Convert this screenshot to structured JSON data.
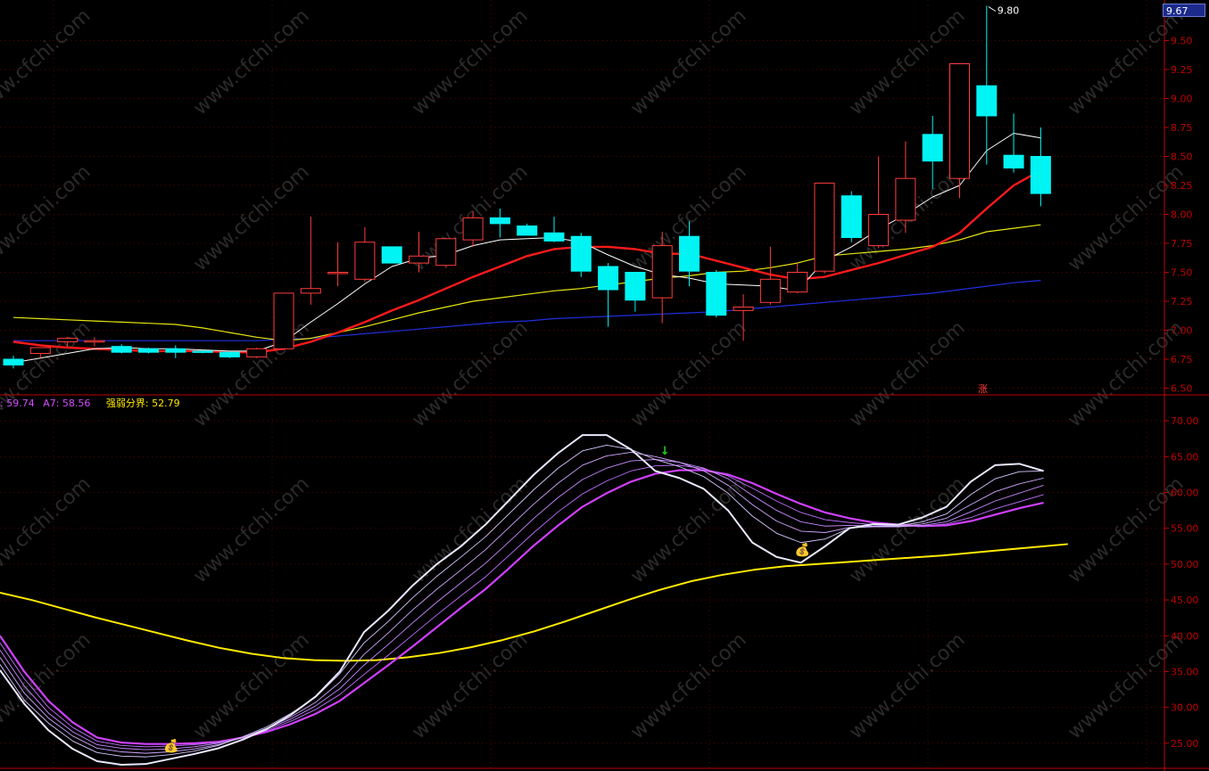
{
  "colors": {
    "up": "#ff3b3b",
    "down": "#00f4f4",
    "ma5": "#ffffff",
    "ma10": "#ff1a1a",
    "ma20": "#e6e60f",
    "ma60": "#1f2fe0",
    "boundary": "#ffea00",
    "grid": "#5a0000",
    "axis": "#c00000",
    "watermark": "#2a2a2a"
  },
  "price_panel": {
    "y_ticks": [
      "9.50",
      "9.25",
      "9.00",
      "8.75",
      "8.50",
      "8.25",
      "8.00",
      "7.75",
      "7.50",
      "7.25",
      "7.00",
      "6.75",
      "6.50"
    ],
    "last_price_label": "9.67",
    "high_marker_label": "9.80",
    "zhang_label": "涨"
  },
  "indicator_panel": {
    "y_ticks": [
      "70.00",
      "65.00",
      "60.00",
      "55.00",
      "50.00",
      "45.00",
      "40.00",
      "35.00",
      "30.00",
      "25.00"
    ],
    "legend_a6": ": 59.74",
    "legend_a7": "A7: 58.56",
    "legend_boundary": "强弱分界: 52.79",
    "money_bag_icon": "💰",
    "arrow_icon": "↓"
  },
  "watermark_text": "www.cfchi.com",
  "chart_data": {
    "type": "candlestick",
    "price_ylim": [
      6.45,
      9.85
    ],
    "candles": [
      {
        "o": 6.75,
        "h": 6.78,
        "l": 6.67,
        "c": 6.7
      },
      {
        "o": 6.8,
        "h": 6.85,
        "l": 6.76,
        "c": 6.85
      },
      {
        "o": 6.9,
        "h": 6.94,
        "l": 6.86,
        "c": 6.93
      },
      {
        "o": 6.91,
        "h": 6.94,
        "l": 6.86,
        "c": 6.91
      },
      {
        "o": 6.86,
        "h": 6.88,
        "l": 6.8,
        "c": 6.81
      },
      {
        "o": 6.84,
        "h": 6.85,
        "l": 6.8,
        "c": 6.81
      },
      {
        "o": 6.84,
        "h": 6.87,
        "l": 6.76,
        "c": 6.81
      },
      {
        "o": 6.82,
        "h": 6.83,
        "l": 6.8,
        "c": 6.81
      },
      {
        "o": 6.81,
        "h": 6.82,
        "l": 6.76,
        "c": 6.77
      },
      {
        "o": 6.77,
        "h": 6.85,
        "l": 6.76,
        "c": 6.84
      },
      {
        "o": 6.84,
        "h": 7.32,
        "l": 6.83,
        "c": 7.32
      },
      {
        "o": 7.32,
        "h": 7.98,
        "l": 7.22,
        "c": 7.36
      },
      {
        "o": 7.5,
        "h": 7.76,
        "l": 7.38,
        "c": 7.5
      },
      {
        "o": 7.44,
        "h": 7.89,
        "l": 7.42,
        "c": 7.76
      },
      {
        "o": 7.72,
        "h": 7.72,
        "l": 7.58,
        "c": 7.58
      },
      {
        "o": 7.58,
        "h": 7.85,
        "l": 7.5,
        "c": 7.64
      },
      {
        "o": 7.56,
        "h": 7.8,
        "l": 7.54,
        "c": 7.79
      },
      {
        "o": 7.78,
        "h": 8.03,
        "l": 7.72,
        "c": 7.97
      },
      {
        "o": 7.97,
        "h": 8.05,
        "l": 7.8,
        "c": 7.92
      },
      {
        "o": 7.9,
        "h": 7.92,
        "l": 7.82,
        "c": 7.82
      },
      {
        "o": 7.84,
        "h": 7.98,
        "l": 7.76,
        "c": 7.77
      },
      {
        "o": 7.81,
        "h": 7.84,
        "l": 7.46,
        "c": 7.51
      },
      {
        "o": 7.55,
        "h": 7.58,
        "l": 7.03,
        "c": 7.35
      },
      {
        "o": 7.5,
        "h": 7.5,
        "l": 7.16,
        "c": 7.26
      },
      {
        "o": 7.28,
        "h": 7.85,
        "l": 7.06,
        "c": 7.73
      },
      {
        "o": 7.81,
        "h": 7.94,
        "l": 7.38,
        "c": 7.51
      },
      {
        "o": 7.5,
        "h": 7.52,
        "l": 7.11,
        "c": 7.13
      },
      {
        "o": 7.17,
        "h": 7.31,
        "l": 6.91,
        "c": 7.2
      },
      {
        "o": 7.24,
        "h": 7.72,
        "l": 7.22,
        "c": 7.44
      },
      {
        "o": 7.33,
        "h": 7.58,
        "l": 7.32,
        "c": 7.5
      },
      {
        "o": 7.51,
        "h": 8.27,
        "l": 7.49,
        "c": 8.27
      },
      {
        "o": 8.16,
        "h": 8.2,
        "l": 7.76,
        "c": 7.8
      },
      {
        "o": 7.73,
        "h": 8.5,
        "l": 7.71,
        "c": 8.0
      },
      {
        "o": 7.95,
        "h": 8.63,
        "l": 7.84,
        "c": 8.31
      },
      {
        "o": 8.69,
        "h": 8.85,
        "l": 8.22,
        "c": 8.46
      },
      {
        "o": 8.31,
        "h": 8.7,
        "l": 8.14,
        "c": 9.3
      },
      {
        "o": 9.11,
        "h": 9.8,
        "l": 8.43,
        "c": 8.85
      },
      {
        "o": 8.51,
        "h": 8.87,
        "l": 8.36,
        "c": 8.4
      },
      {
        "o": 8.5,
        "h": 8.75,
        "l": 8.07,
        "c": 8.18
      }
    ],
    "ma5": [
      6.72,
      6.76,
      6.8,
      6.84,
      6.85,
      6.84,
      6.84,
      6.83,
      6.82,
      6.82,
      6.9,
      7.07,
      7.23,
      7.4,
      7.55,
      7.62,
      7.65,
      7.73,
      7.78,
      7.79,
      7.8,
      7.76,
      7.65,
      7.55,
      7.48,
      7.45,
      7.4,
      7.39,
      7.38,
      7.34,
      7.6,
      7.72,
      7.87,
      8.0,
      8.15,
      8.25,
      8.55,
      8.7,
      8.66
    ],
    "ma10": [
      6.9,
      6.87,
      6.85,
      6.84,
      6.83,
      6.82,
      6.82,
      6.82,
      6.81,
      6.81,
      6.84,
      6.9,
      6.98,
      7.07,
      7.17,
      7.26,
      7.36,
      7.46,
      7.55,
      7.64,
      7.7,
      7.72,
      7.72,
      7.7,
      7.66,
      7.66,
      7.6,
      7.54,
      7.48,
      7.44,
      7.46,
      7.52,
      7.58,
      7.65,
      7.72,
      7.84,
      8.05,
      8.25,
      8.38
    ],
    "ma20": [
      7.11,
      7.1,
      7.09,
      7.08,
      7.07,
      7.06,
      7.05,
      7.02,
      6.98,
      6.94,
      6.91,
      6.93,
      6.98,
      7.03,
      7.09,
      7.15,
      7.2,
      7.25,
      7.28,
      7.31,
      7.34,
      7.36,
      7.39,
      7.42,
      7.45,
      7.47,
      7.5,
      7.51,
      7.54,
      7.58,
      7.64,
      7.66,
      7.68,
      7.7,
      7.73,
      7.78,
      7.85,
      7.88,
      7.91
    ],
    "ma60": [
      6.91,
      6.91,
      6.91,
      6.91,
      6.91,
      6.91,
      6.91,
      6.91,
      6.91,
      6.91,
      6.92,
      6.93,
      6.95,
      6.97,
      6.99,
      7.01,
      7.03,
      7.05,
      7.07,
      7.08,
      7.1,
      7.11,
      7.12,
      7.13,
      7.14,
      7.15,
      7.16,
      7.18,
      7.2,
      7.22,
      7.24,
      7.26,
      7.28,
      7.3,
      7.32,
      7.35,
      7.38,
      7.41,
      7.43
    ],
    "indicator_ylim": [
      21.5,
      72.0
    ],
    "A1": [
      35.2,
      30.5,
      26.8,
      24.2,
      22.5,
      22.0,
      22.1,
      22.8,
      23.5,
      24.3,
      25.5,
      27.0,
      29.0,
      31.5,
      35.0,
      40.5,
      43.5,
      47.0,
      50.0,
      52.5,
      55.5,
      59.0,
      62.5,
      65.5,
      68.0,
      68.0,
      66.0,
      63.0,
      62.0,
      60.5,
      57.5,
      53.0,
      51.0,
      50.2,
      52.5,
      55.0,
      55.6,
      55.5,
      56.5,
      58.0,
      61.5,
      63.8,
      64.0,
      63.0
    ],
    "A2": [
      36.0,
      31.0,
      27.8,
      25.3,
      23.7,
      23.2,
      23.1,
      23.4,
      23.9,
      24.7,
      25.9,
      27.3,
      29.2,
      31.4,
      34.7,
      39.0,
      42.0,
      45.3,
      48.3,
      51.0,
      53.8,
      57.1,
      60.4,
      63.4,
      65.8,
      66.6,
      66.0,
      64.6,
      63.6,
      62.2,
      59.9,
      56.7,
      54.3,
      53.0,
      53.5,
      55.0,
      55.3,
      55.3,
      55.9,
      57.0,
      59.7,
      61.9,
      62.9,
      63.0
    ],
    "A3": [
      37.0,
      32.0,
      28.5,
      26.0,
      24.3,
      23.8,
      23.6,
      23.8,
      24.2,
      24.8,
      25.8,
      27.1,
      28.7,
      30.7,
      33.5,
      37.4,
      40.4,
      43.6,
      46.5,
      49.2,
      52.0,
      55.2,
      58.4,
      61.3,
      63.8,
      65.1,
      65.6,
      65.0,
      64.2,
      63.0,
      61.0,
      58.3,
      56.0,
      54.6,
      54.4,
      55.1,
      55.2,
      55.2,
      55.6,
      56.4,
      58.3,
      60.1,
      61.2,
      62.0
    ],
    "A4": [
      38.0,
      33.0,
      29.2,
      26.6,
      24.8,
      24.3,
      24.1,
      24.2,
      24.5,
      25.0,
      25.8,
      27.0,
      28.4,
      30.2,
      32.6,
      35.9,
      38.8,
      41.8,
      44.7,
      47.4,
      50.1,
      53.2,
      56.4,
      59.3,
      61.8,
      63.4,
      64.4,
      64.6,
      64.2,
      63.4,
      61.9,
      59.6,
      57.5,
      55.9,
      55.3,
      55.4,
      55.3,
      55.2,
      55.4,
      55.9,
      57.3,
      58.8,
      59.9,
      61.0
    ],
    "A5": [
      39.0,
      34.0,
      30.0,
      27.2,
      25.3,
      24.7,
      24.5,
      24.6,
      24.8,
      25.1,
      25.8,
      26.8,
      28.1,
      29.7,
      31.8,
      34.6,
      37.3,
      40.1,
      42.9,
      45.6,
      48.2,
      51.3,
      54.4,
      57.3,
      59.8,
      61.6,
      63.0,
      63.7,
      63.8,
      63.3,
      62.3,
      60.6,
      58.8,
      57.2,
      56.2,
      55.8,
      55.5,
      55.3,
      55.3,
      55.6,
      56.5,
      57.7,
      58.7,
      59.7
    ],
    "A6": [
      40.0,
      35.0,
      30.9,
      27.9,
      25.8,
      25.1,
      24.9,
      24.9,
      25.0,
      25.2,
      25.8,
      26.6,
      27.7,
      29.1,
      30.9,
      33.4,
      35.9,
      38.5,
      41.2,
      43.9,
      46.5,
      49.5,
      52.6,
      55.4,
      58.0,
      59.9,
      61.5,
      62.6,
      63.1,
      63.1,
      62.5,
      61.3,
      59.8,
      58.4,
      57.2,
      56.4,
      55.8,
      55.5,
      55.3,
      55.4,
      56.0,
      56.9,
      57.8,
      58.56
    ],
    "boundary": [
      46.0,
      45.0,
      43.8,
      42.6,
      41.5,
      40.4,
      39.3,
      38.3,
      37.5,
      36.9,
      36.6,
      36.5,
      36.6,
      37.0,
      37.6,
      38.4,
      39.4,
      40.6,
      42.0,
      43.5,
      45.0,
      46.4,
      47.6,
      48.5,
      49.2,
      49.7,
      50.0,
      50.3,
      50.6,
      50.9,
      51.2,
      51.6,
      52.0,
      52.4,
      52.79
    ],
    "events": {
      "money_bag_bars": [
        7,
        33
      ],
      "arrow_bar": 24
    }
  }
}
